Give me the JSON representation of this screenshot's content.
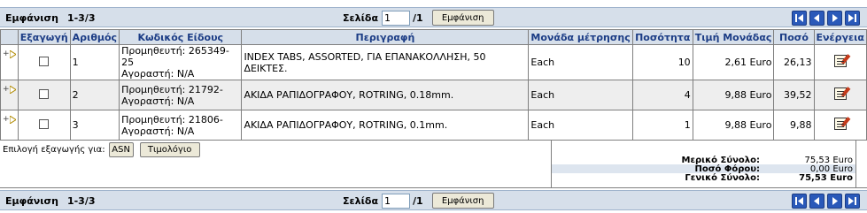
{
  "pager": {
    "show_label": "Εμφάνιση",
    "range": "1-3/3",
    "page_label": "Σελίδα",
    "page_value": "1",
    "page_of": "/1",
    "show_button": "Εμφάνιση"
  },
  "columns": [
    "Εξαγωγή",
    "Αριθμός",
    "Κωδικός Είδους",
    "Περιγραφή",
    "Μονάδα μέτρησης",
    "Ποσότητα",
    "Τιμή Μονάδας",
    "Ποσό",
    "Ενέργεια"
  ],
  "rows": [
    {
      "num": "1",
      "code_line1": "Προμηθευτή: 265349-25",
      "code_line2": "Αγοραστή: N/A",
      "desc": "INDEX TABS, ASSORTED, ΓΙΑ ΕΠΑΝΑΚΟΛΛΗΣΗ, 50 ΔΕΙΚΤΕΣ.",
      "unit": "Each",
      "qty": "10",
      "price": "2,61 Euro",
      "amount": "26,13"
    },
    {
      "num": "2",
      "code_line1": "Προμηθευτή: 21792-",
      "code_line2": "Αγοραστή: N/A",
      "desc": "ΑΚΙΔΑ ΡΑΠΙΔΟΓΡΑΦΟΥ, ROTRING, 0.18mm.",
      "unit": "Each",
      "qty": "4",
      "price": "9,88 Euro",
      "amount": "39,52"
    },
    {
      "num": "3",
      "code_line1": "Προμηθευτή: 21806-",
      "code_line2": "Αγοραστή: N/A",
      "desc": "ΑΚΙΔΑ ΡΑΠΙΔΟΓΡΑΦΟΥ, ROTRING, 0.1mm.",
      "unit": "Each",
      "qty": "1",
      "price": "9,88 Euro",
      "amount": "9,88"
    }
  ],
  "footer": {
    "export_label": "Επιλογή εξαγωγής για:",
    "asn_button": "ASN",
    "invoice_button": "Τιμολόγιο"
  },
  "totals": {
    "subtotal_label": "Μερικό Σύνολο:",
    "subtotal_value": "75,53 Euro",
    "tax_label": "Ποσό Φόρου:",
    "tax_value": "0,00 Euro",
    "grand_label": "Γενικό Σύνολο:",
    "grand_value": "75,53 Euro"
  },
  "icons": {
    "nav": [
      "first-page-icon",
      "prev-page-icon",
      "next-page-icon",
      "last-page-icon"
    ],
    "row_expand": "expand-row-icon",
    "row_action": "edit-document-icon"
  },
  "colors": {
    "bar_bg": "#d6dfea",
    "header_text": "#1b3c85",
    "nav_button": "#2a59b9",
    "alt_row": "#eeeeee"
  }
}
